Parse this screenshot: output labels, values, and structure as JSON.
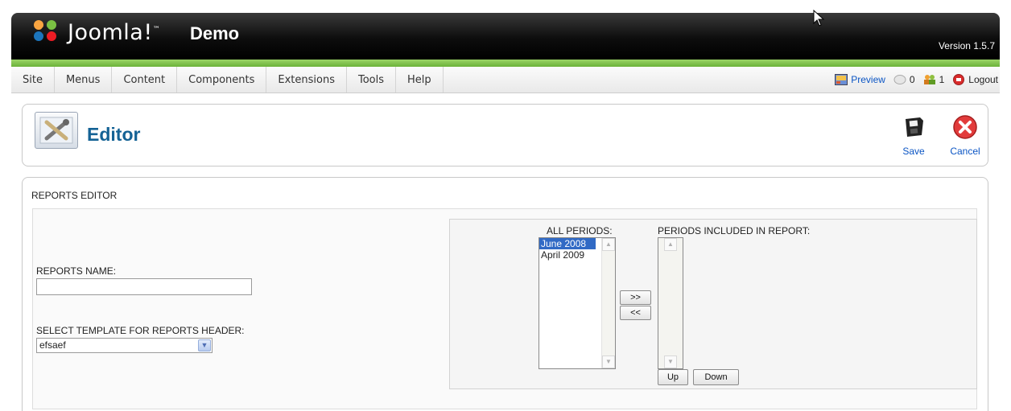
{
  "header": {
    "brand": "Joomla!",
    "brand_tm": "™",
    "site_name": "Demo",
    "version": "Version 1.5.7"
  },
  "menu": {
    "items": [
      "Site",
      "Menus",
      "Content",
      "Components",
      "Extensions",
      "Tools",
      "Help"
    ]
  },
  "status": {
    "preview": "Preview",
    "messages_count": "0",
    "users_count": "1",
    "logout": "Logout"
  },
  "toolbar": {
    "title": "Editor",
    "save_label": "Save",
    "cancel_label": "Cancel"
  },
  "main": {
    "section_title": "REPORTS EDITOR",
    "reports_name_label": "REPORTS NAME:",
    "reports_name_value": "",
    "template_label": "SELECT TEMPLATE FOR REPORTS HEADER:",
    "template_selected": "efsaef",
    "all_periods_label": "ALL PERIODS:",
    "all_periods": [
      "June 2008",
      "April 2009"
    ],
    "all_periods_selected_index": 0,
    "included_label": "PERIODS INCLUDED IN REPORT:",
    "included_periods": [],
    "add_button": ">>",
    "remove_button": "<<",
    "up_button": "Up",
    "down_button": "Down"
  },
  "colors": {
    "title_blue": "#146295",
    "link_blue": "#0b55c4",
    "green_bar": "#7cc24a",
    "selection_blue": "#316ac5"
  }
}
